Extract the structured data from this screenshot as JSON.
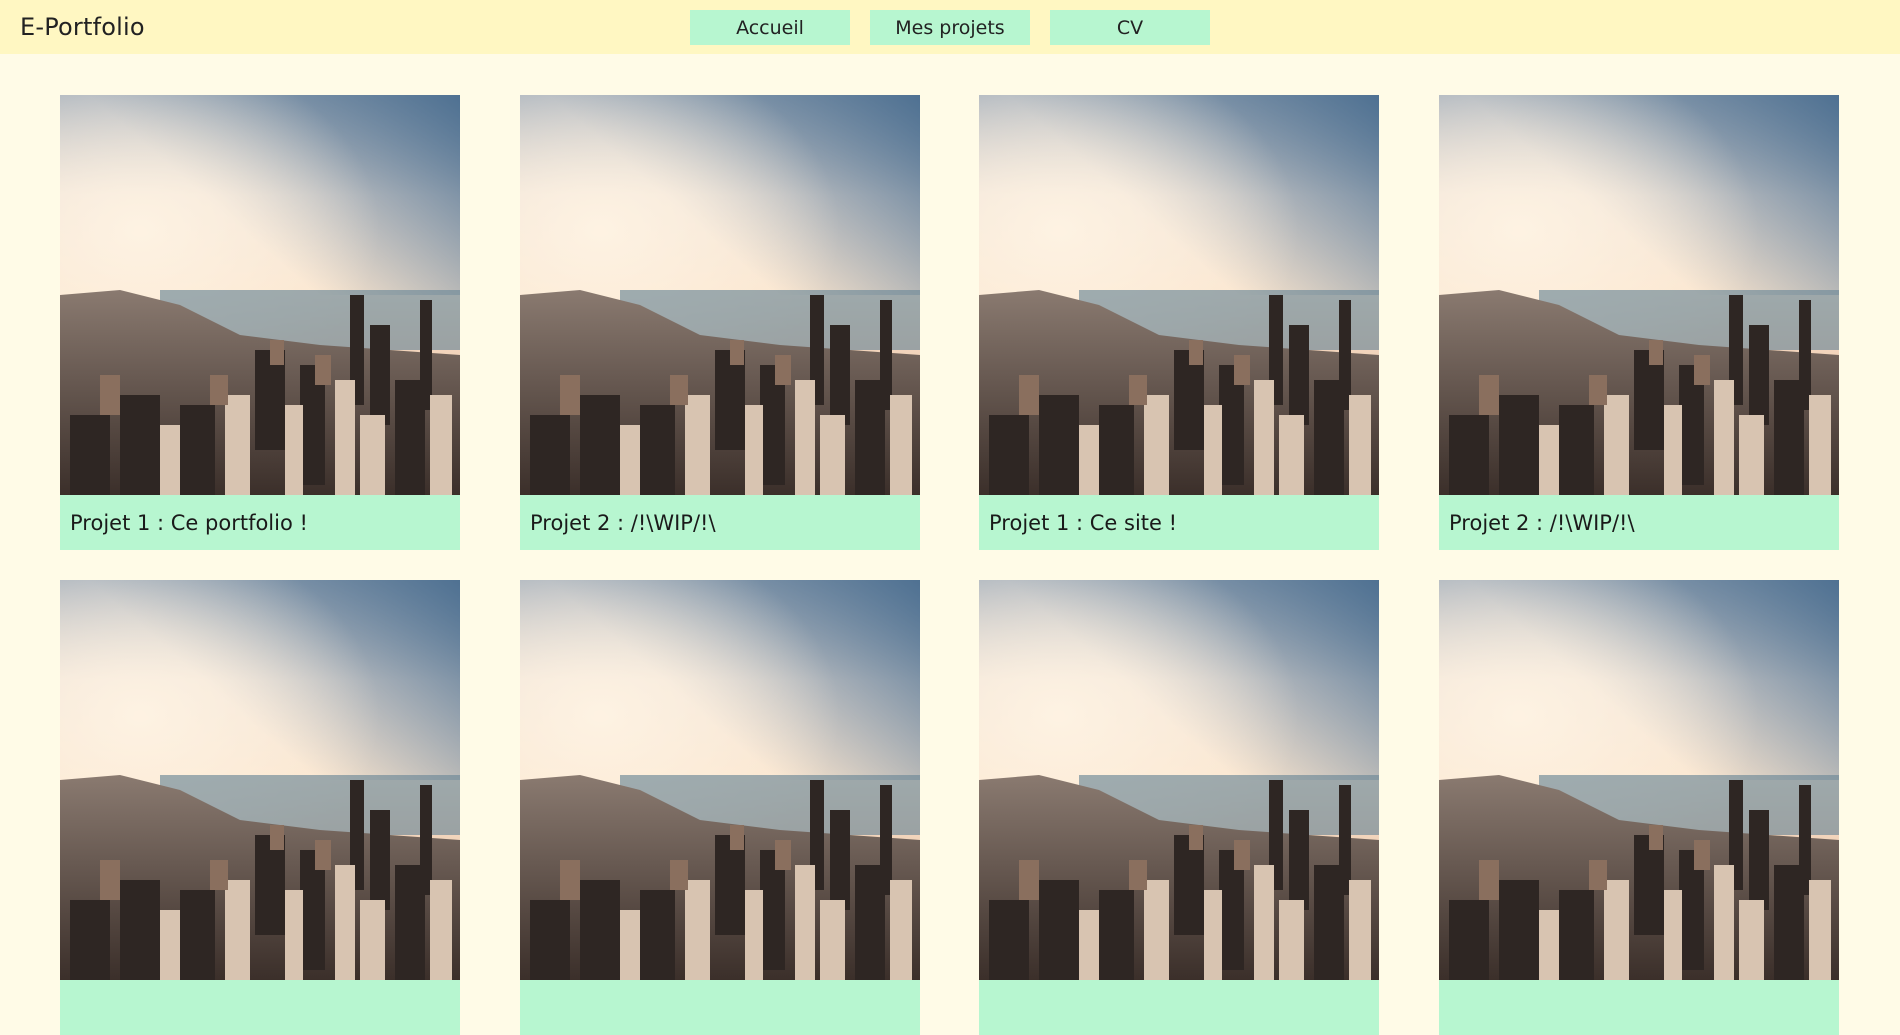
{
  "header": {
    "brand": "E-Portfolio",
    "nav": [
      "Accueil",
      "Mes projets",
      "CV"
    ]
  },
  "projects": [
    {
      "title": "Projet 1 : Ce portfolio !"
    },
    {
      "title": "Projet 2 : /!\\WIP/!\\"
    },
    {
      "title": "Projet 1 : Ce site !"
    },
    {
      "title": "Projet 2 : /!\\WIP/!\\"
    },
    {
      "title": ""
    },
    {
      "title": ""
    },
    {
      "title": ""
    },
    {
      "title": ""
    }
  ],
  "colors": {
    "page_bg": "#fffbe7",
    "header_bg": "#fff7c2",
    "accent": "#b7f6d0"
  },
  "image": "city-skyline-photo"
}
